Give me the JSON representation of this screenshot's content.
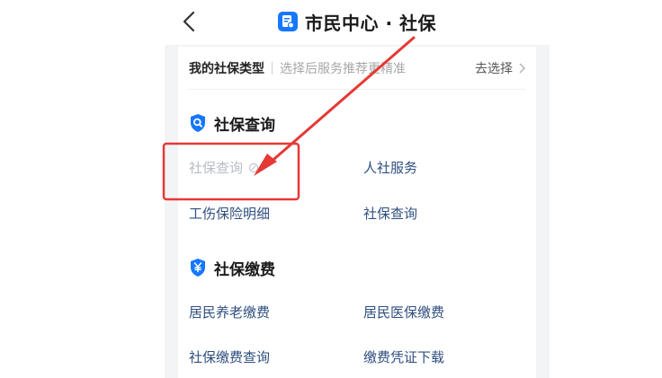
{
  "header": {
    "title": "市民中心 · 社保",
    "back_icon": "chevron-left-icon",
    "app_icon": "document-icon",
    "brand_color": "#1677ff"
  },
  "type_row": {
    "label": "我的社保类型",
    "hint": "选择后服务推荐更精准",
    "action": "去选择"
  },
  "sections": [
    {
      "icon": "search-shield-icon",
      "title": "社保查询",
      "items": [
        {
          "label": "社保查询",
          "disabled": true,
          "badge_icon": "link-icon"
        },
        {
          "label": "人社服务"
        },
        {
          "label": "工伤保险明细"
        },
        {
          "label": "社保查询"
        }
      ]
    },
    {
      "icon": "yen-shield-icon",
      "title": "社保缴费",
      "items": [
        {
          "label": "居民养老缴费"
        },
        {
          "label": "居民医保缴费"
        },
        {
          "label": "社保缴费查询"
        },
        {
          "label": "缴费凭证下载"
        }
      ]
    }
  ],
  "annotation": {
    "color": "#e53935"
  }
}
